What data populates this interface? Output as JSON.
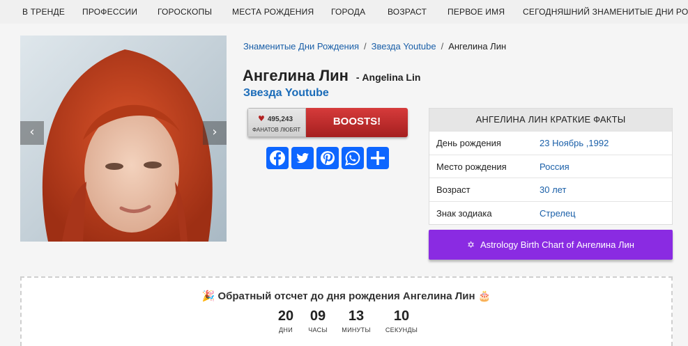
{
  "nav": {
    "items": [
      "В ТРЕНДЕ",
      "ПРОФЕССИИ",
      "ГОРОСКОПЫ",
      "МЕСТА РОЖДЕНИЯ",
      "ГОРОДА",
      "ВОЗРАСТ",
      "ПЕРВОЕ ИМЯ",
      "СЕГОДНЯШНИЙ ЗНАМЕНИТЫЕ ДНИ РОЖДЕНИЯ"
    ]
  },
  "breadcrumb": {
    "home": "Знаменитые Дни Рождения",
    "category": "Звезда Youtube",
    "current": "Ангелина Лин",
    "separator": "/"
  },
  "profile": {
    "name_ru": "Ангелина Лин",
    "name_en": "- Angelina Lin",
    "profession": "Звезда Youtube"
  },
  "boost": {
    "fan_count": "495,243",
    "fans_label": "ФАНАТОВ ЛЮБЯТ",
    "button_label": "BOOSTS!"
  },
  "share": {
    "buttons": [
      "facebook",
      "twitter",
      "pinterest",
      "whatsapp",
      "share"
    ]
  },
  "facts": {
    "title": "АНГЕЛИНА ЛИН КРАТКИЕ ФАКТЫ",
    "rows": [
      {
        "label": "День рождения",
        "value": "23 Ноябрь ,1992"
      },
      {
        "label": "Место рождения",
        "value": "Россия"
      },
      {
        "label": "Возраст",
        "value": "30 лет"
      },
      {
        "label": "Знак зодиака",
        "value": "Стрелец"
      }
    ]
  },
  "astro_button": {
    "icon": "✡",
    "label": "Astrology Birth Chart of Ангелина Лин"
  },
  "countdown": {
    "icon_left": "🎉",
    "icon_right": "🎂",
    "title": "Обратный отсчет до дня рождения Ангелина Лин",
    "units": [
      {
        "value": "20",
        "label": "ДНИ"
      },
      {
        "value": "09",
        "label": "ЧАСЫ"
      },
      {
        "value": "13",
        "label": "МИНУТЫ"
      },
      {
        "value": "10",
        "label": "СЕКУНДЫ"
      }
    ]
  },
  "colors": {
    "link": "#1a5fa8",
    "boost_red": "#c62c2c",
    "astro_purple": "#8a2be2"
  }
}
